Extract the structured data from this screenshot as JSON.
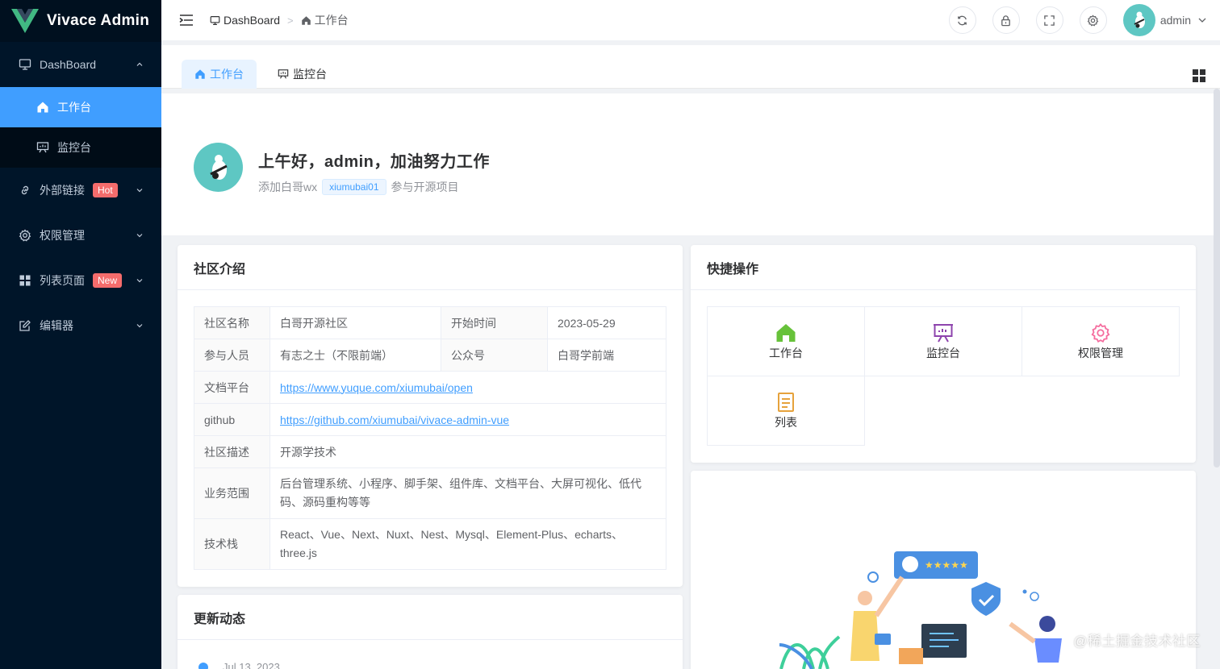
{
  "app": {
    "title": "Vivace Admin"
  },
  "sidebar": {
    "items": [
      {
        "label": "DashBoard",
        "icon": "monitor-icon"
      },
      {
        "label": "工作台",
        "icon": "home-icon"
      },
      {
        "label": "监控台",
        "icon": "monitor-board-icon"
      },
      {
        "label": "外部链接",
        "icon": "link-icon",
        "badge": "Hot"
      },
      {
        "label": "权限管理",
        "icon": "gear-icon"
      },
      {
        "label": "列表页面",
        "icon": "grid-icon",
        "badge": "New"
      },
      {
        "label": "编辑器",
        "icon": "edit-icon"
      }
    ]
  },
  "header": {
    "breadcrumb": [
      "DashBoard",
      "工作台"
    ],
    "username": "admin"
  },
  "tabs": [
    {
      "label": "工作台",
      "active": true
    },
    {
      "label": "监控台",
      "active": false
    }
  ],
  "greeting": {
    "title": "上午好，admin，加油努力工作",
    "prefix": "添加白哥wx",
    "wx": "xiumubai01",
    "suffix": "参与开源项目"
  },
  "community": {
    "title": "社区介绍",
    "rows": {
      "name_label": "社区名称",
      "name": "白哥开源社区",
      "start_label": "开始时间",
      "start": "2023-05-29",
      "members_label": "参与人员",
      "members": "有志之士（不限前端）",
      "wechat_label": "公众号",
      "wechat": "白哥学前端",
      "docs_label": "文档平台",
      "docs": "https://www.yuque.com/xiumubai/open",
      "github_label": "github",
      "github": "https://github.com/xiumubai/vivace-admin-vue",
      "desc_label": "社区描述",
      "desc": "开源学技术",
      "scope_label": "业务范围",
      "scope": "后台管理系统、小程序、脚手架、组件库、文档平台、大屏可视化、低代码、源码重构等等",
      "stack_label": "技术栈",
      "stack": "React、Vue、Next、Nuxt、Nest、Mysql、Element-Plus、echarts、three.js"
    }
  },
  "quick": {
    "title": "快捷操作",
    "items": [
      {
        "label": "工作台",
        "icon": "home-icon",
        "color": "#67c23a"
      },
      {
        "label": "监控台",
        "icon": "monitor-board-icon",
        "color": "#8e44ad"
      },
      {
        "label": "权限管理",
        "icon": "gear-icon",
        "color": "#f56c9e"
      },
      {
        "label": "列表",
        "icon": "document-icon",
        "color": "#e6a23c"
      }
    ]
  },
  "updates": {
    "title": "更新动态",
    "first_date": "Jul 13, 2023"
  },
  "watermark": "@稀土掘金技术社区",
  "colors": {
    "sidebar": "#001529",
    "accent": "#409eff",
    "badge": "#f56c6c"
  }
}
